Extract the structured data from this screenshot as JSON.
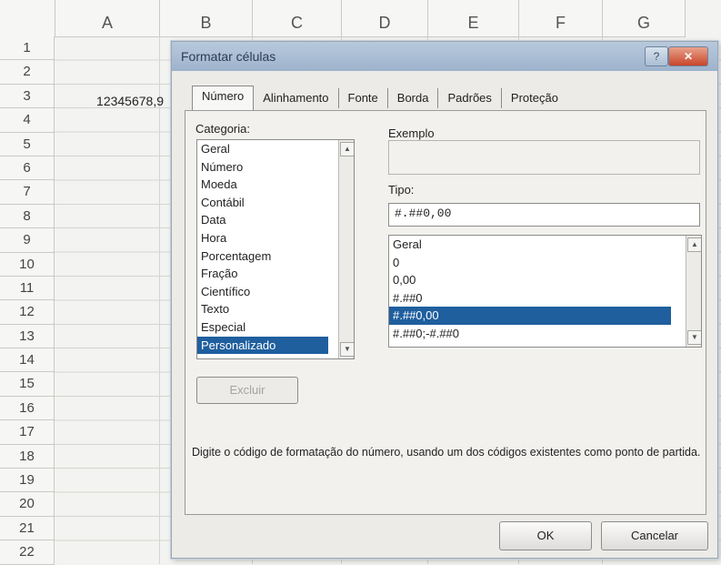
{
  "sheet": {
    "columns": [
      "A",
      "B",
      "C",
      "D",
      "E",
      "F",
      "G"
    ],
    "rows": [
      "1",
      "2",
      "3",
      "4",
      "5",
      "6",
      "7",
      "8",
      "9",
      "10",
      "11",
      "12",
      "13",
      "14",
      "15",
      "16",
      "17",
      "18",
      "19",
      "20",
      "21",
      "22"
    ],
    "cell_A3_value": "12345678,9"
  },
  "dialog": {
    "title": "Formatar células",
    "help_glyph": "?",
    "close_glyph": "✕",
    "tabs": [
      "Número",
      "Alinhamento",
      "Fonte",
      "Borda",
      "Padrões",
      "Proteção"
    ],
    "category_label": "Categoria:",
    "categories": [
      "Geral",
      "Número",
      "Moeda",
      "Contábil",
      "Data",
      "Hora",
      "Porcentagem",
      "Fração",
      "Científico",
      "Texto",
      "Especial",
      "Personalizado"
    ],
    "selected_category": "Personalizado",
    "sample_label": "Exemplo",
    "sample_value": "",
    "type_label": "Tipo:",
    "type_value": "#.##0,00",
    "type_list": [
      "Geral",
      "0",
      "0,00",
      "#.##0",
      "#.##0,00",
      "#.##0;-#.##0"
    ],
    "selected_type": "#.##0,00",
    "delete_label": "Excluir",
    "description": "Digite o código de formatação do número, usando um dos códigos existentes como ponto de partida.",
    "ok_label": "OK",
    "cancel_label": "Cancelar"
  },
  "colors": {
    "selection": "#1f5f9e",
    "titlebar": "#9db3cc",
    "close_button": "#c9452a"
  },
  "icons": [
    "close-icon",
    "help-icon",
    "scroll-up-icon",
    "scroll-down-icon"
  ]
}
